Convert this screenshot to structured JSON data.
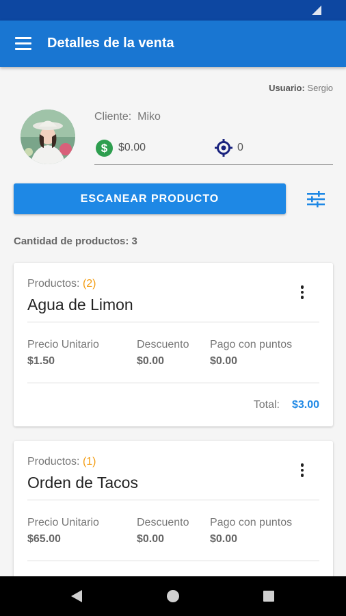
{
  "app_bar": {
    "title": "Detalles de la venta"
  },
  "user": {
    "label": "Usuario:",
    "name": "Sergio"
  },
  "client": {
    "label": "Cliente:",
    "name": "Miko",
    "balance": "$0.00",
    "points": "0"
  },
  "actions": {
    "scan_label": "ESCANEAR PRODUCTO"
  },
  "summary": {
    "count_text": "Cantidad de productos: 3"
  },
  "products": [
    {
      "label": "Productos:",
      "qty": "(2)",
      "name": "Agua de Limon",
      "unit_price_label": "Precio Unitario",
      "unit_price": "$1.50",
      "discount_label": "Descuento",
      "discount": "$0.00",
      "points_label": "Pago con puntos",
      "points_payment": "$0.00",
      "total_label": "Total:",
      "total": "$3.00"
    },
    {
      "label": "Productos:",
      "qty": "(1)",
      "name": "Orden de Tacos",
      "unit_price_label": "Precio Unitario",
      "unit_price": "$65.00",
      "discount_label": "Descuento",
      "discount": "$0.00",
      "points_label": "Pago con puntos",
      "points_payment": "$0.00"
    }
  ],
  "icons": {
    "menu": "menu-icon",
    "money": "dollar-icon",
    "points": "target-icon",
    "filter": "tune-icon",
    "more": "more-vert-icon"
  },
  "colors": {
    "status_bar": "#0d47a1",
    "app_bar": "#1976d2",
    "primary_button": "#1e88e5",
    "accent_orange": "#f39c12",
    "money_green": "#2e9e4f",
    "points_navy": "#1a237e"
  }
}
